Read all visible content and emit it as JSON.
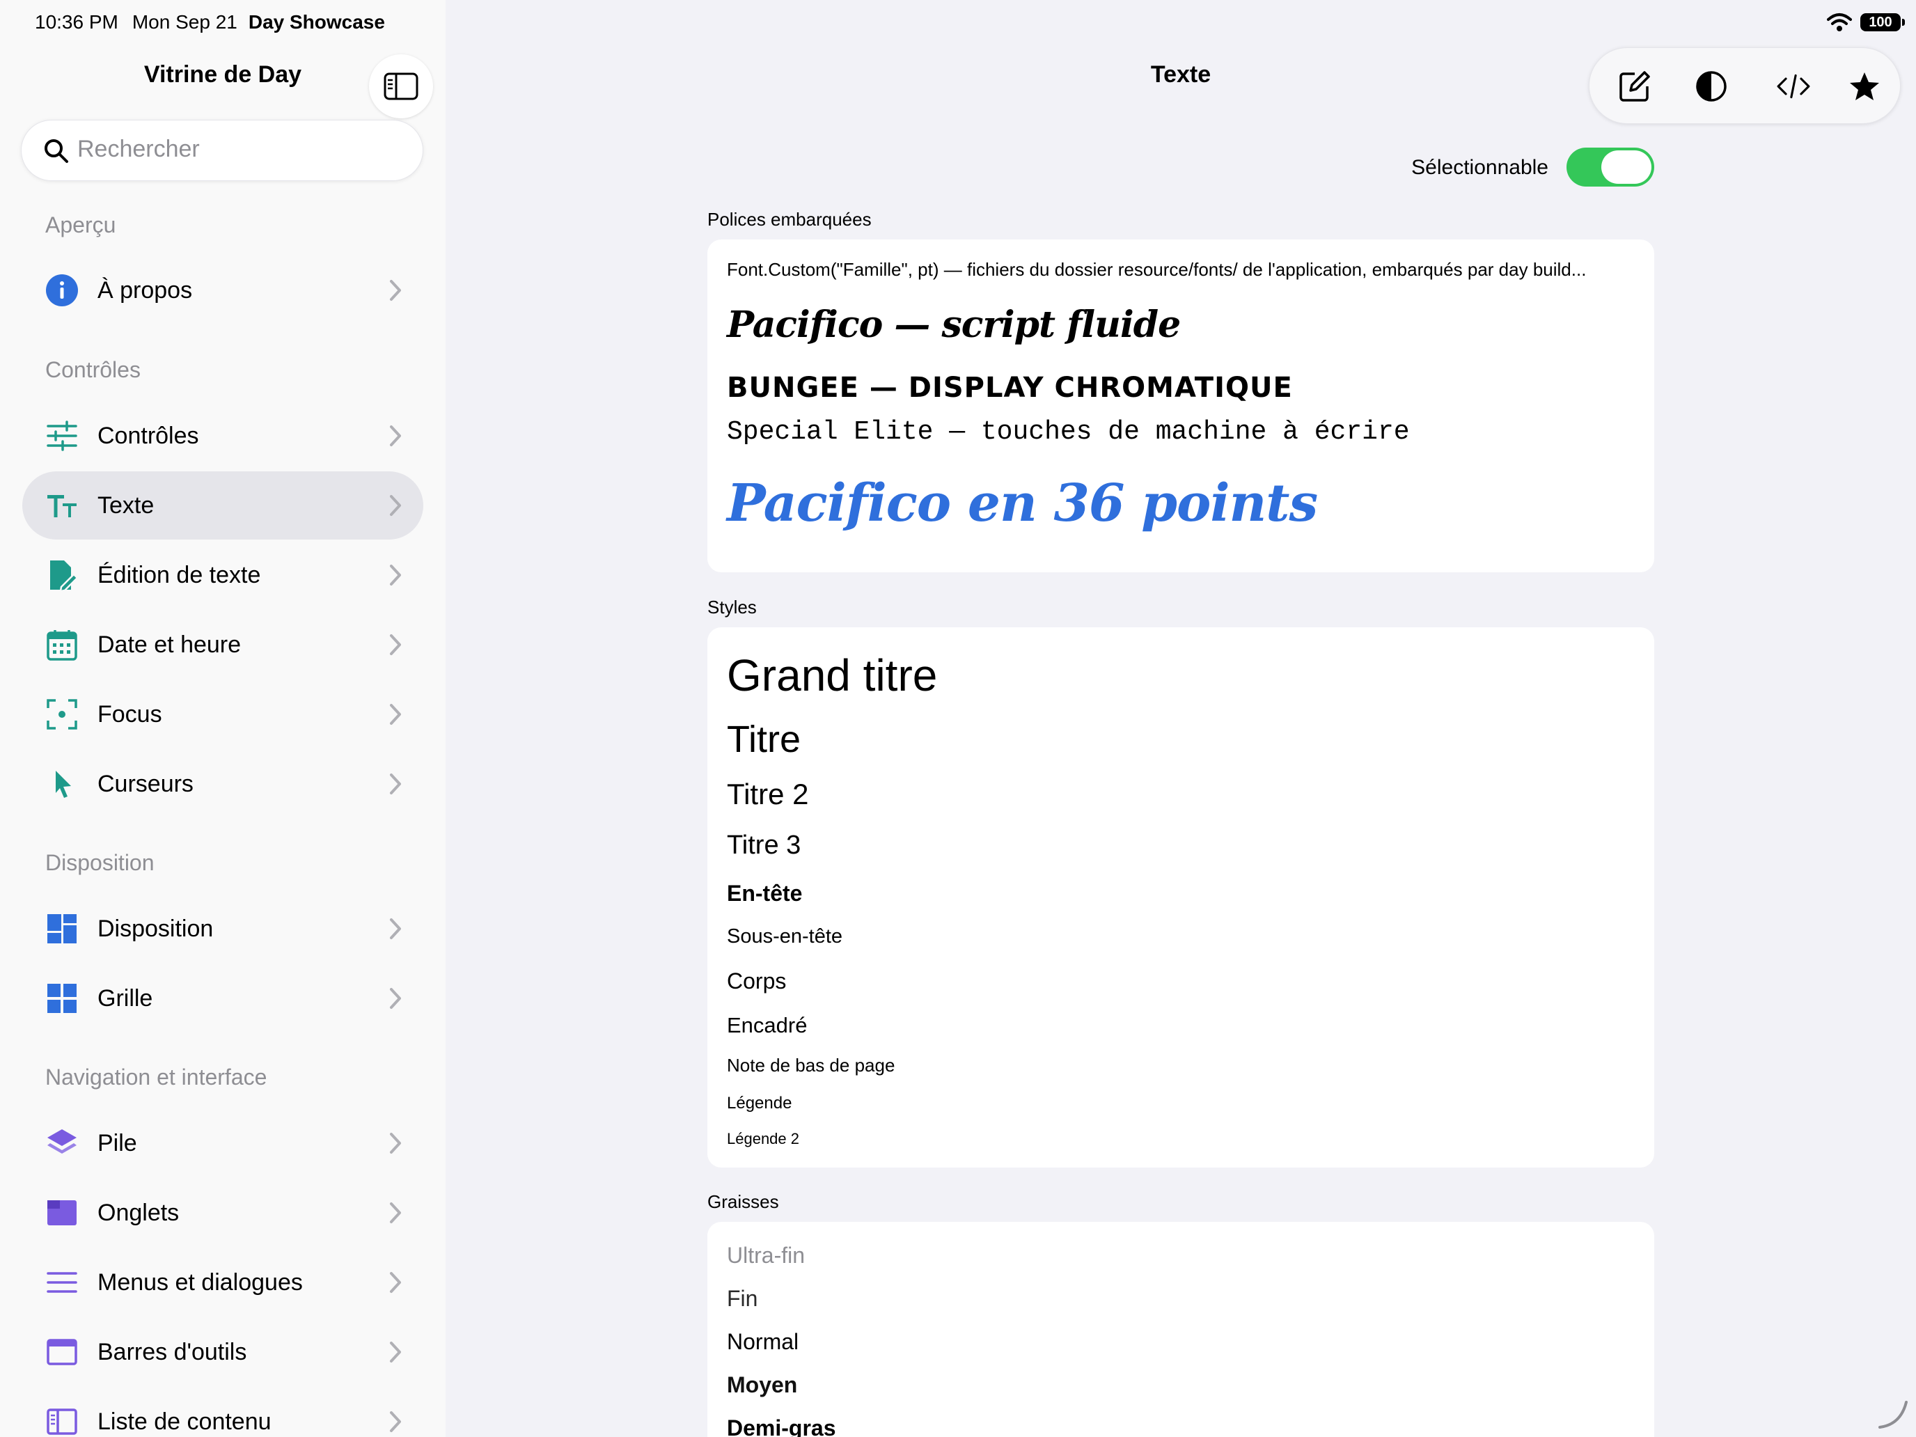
{
  "status": {
    "time": "10:36 PM",
    "date": "Mon Sep 21",
    "app": "Day Showcase",
    "battery": "100"
  },
  "sidebar": {
    "title": "Vitrine de Day",
    "search_placeholder": "Rechercher",
    "sections": [
      {
        "header": "Aperçu",
        "items": [
          {
            "label": "À propos",
            "icon": "info-icon"
          }
        ]
      },
      {
        "header": "Contrôles",
        "items": [
          {
            "label": "Contrôles",
            "icon": "sliders-icon"
          },
          {
            "label": "Texte",
            "icon": "text-size-icon",
            "selected": true
          },
          {
            "label": "Édition de texte",
            "icon": "document-edit-icon"
          },
          {
            "label": "Date et heure",
            "icon": "calendar-icon"
          },
          {
            "label": "Focus",
            "icon": "focus-icon"
          },
          {
            "label": "Curseurs",
            "icon": "cursor-icon"
          }
        ]
      },
      {
        "header": "Disposition",
        "items": [
          {
            "label": "Disposition",
            "icon": "layout-icon"
          },
          {
            "label": "Grille",
            "icon": "grid-icon"
          }
        ]
      },
      {
        "header": "Navigation et interface",
        "items": [
          {
            "label": "Pile",
            "icon": "stack-icon"
          },
          {
            "label": "Onglets",
            "icon": "tabs-icon"
          },
          {
            "label": "Menus et dialogues",
            "icon": "menu-icon"
          },
          {
            "label": "Barres d'outils",
            "icon": "toolbar-icon"
          },
          {
            "label": "Liste de contenu",
            "icon": "sidebar-list-icon"
          }
        ]
      }
    ]
  },
  "main": {
    "title": "Texte",
    "toolbar_icons": [
      "compose-icon",
      "contrast-icon",
      "code-icon",
      "star-icon"
    ],
    "selectable_label": "Sélectionnable",
    "selectable_on": true,
    "embedded_fonts": {
      "header": "Polices embarquées",
      "description": "Font.Custom(\"Famille\", pt) — fichiers du dossier resource/fonts/ de l'application, embarqués par day build...",
      "pacifico": "Pacifico — script fluide",
      "bungee": "BUNGEE — DISPLAY CHROMATIQUE",
      "special_elite": "Special Elite — touches de machine à écrire",
      "pacifico36": "Pacifico en 36 points",
      "accent_color": "#2f6fdc"
    },
    "styles": {
      "header": "Styles",
      "items": [
        "Grand titre",
        "Titre",
        "Titre 2",
        "Titre 3",
        "En-tête",
        "Sous-en-tête",
        "Corps",
        "Encadré",
        "Note de bas de page",
        "Légende",
        "Légende 2"
      ]
    },
    "weights": {
      "header": "Graisses",
      "items": [
        "Ultra-fin",
        "Fin",
        "Normal",
        "Moyen",
        "Demi-gras"
      ]
    }
  },
  "colors": {
    "teal_icon": "#1e9a8a",
    "blue_icon": "#2f6fdc",
    "purple_icon": "#7a5be0",
    "toggle_green": "#34c759",
    "selection_bg": "#e5e5ea"
  }
}
